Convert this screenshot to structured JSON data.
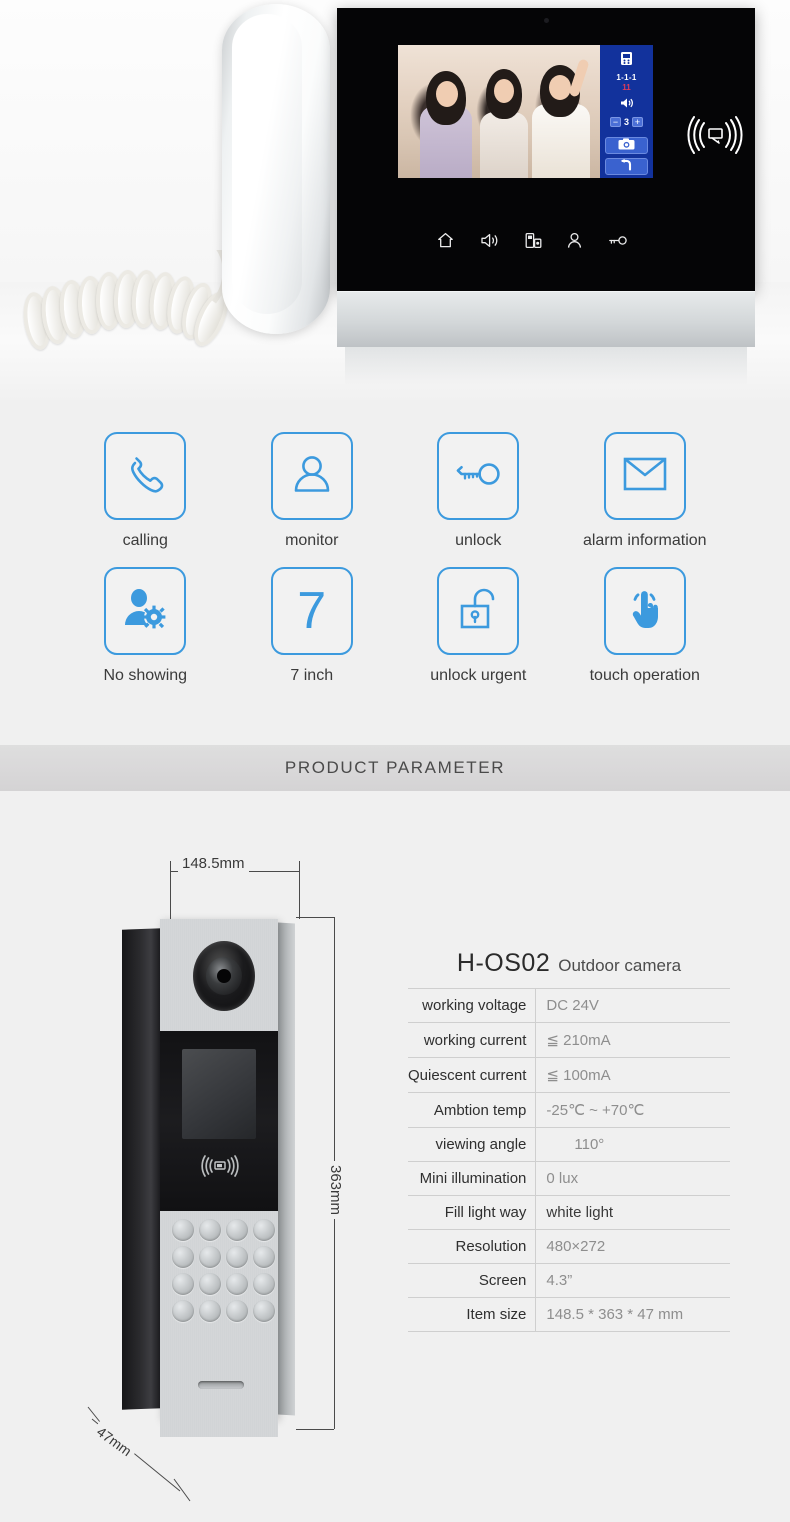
{
  "hero": {
    "device_name": "video-door-phone-indoor-monitor",
    "osd": {
      "station_icon": "door-station-icon",
      "address": "1-1-1",
      "call_number": "11",
      "volume_icon": "speaker-icon",
      "volume_minus": "−",
      "volume_value": "3",
      "volume_plus": "+",
      "snapshot_icon": "camera-icon",
      "back_icon": "back-arrow-icon"
    },
    "touchbar": [
      {
        "name": "home-icon",
        "label": "home"
      },
      {
        "name": "volume-icon",
        "label": "volume"
      },
      {
        "name": "monitor-icon",
        "label": "monitor"
      },
      {
        "name": "contact-icon",
        "label": "contact"
      },
      {
        "name": "key-icon",
        "label": "unlock"
      }
    ],
    "rfid_icon": "rfid-reader-icon"
  },
  "features": {
    "row1": [
      {
        "icon": "phone-handset-icon",
        "label": "calling"
      },
      {
        "icon": "person-icon",
        "label": "monitor"
      },
      {
        "icon": "key-icon",
        "label": "unlock"
      },
      {
        "icon": "envelope-icon",
        "label": "alarm information"
      }
    ],
    "row2": [
      {
        "icon": "person-gear-icon",
        "label": "No showing"
      },
      {
        "icon": "number-seven",
        "glyph": "7",
        "label": "7 inch"
      },
      {
        "icon": "open-padlock-icon",
        "label": "unlock urgent"
      },
      {
        "icon": "touch-finger-icon",
        "label": "touch operation"
      }
    ]
  },
  "banner": {
    "title": "PRODUCT PARAMETER"
  },
  "dimensions": {
    "width": "148.5mm",
    "height": "363mm",
    "depth": "47mm"
  },
  "spec": {
    "model": "H-OS02",
    "subtitle": "Outdoor camera",
    "rows": [
      {
        "key": "working voltage",
        "value": "DC 24V",
        "dark": false
      },
      {
        "key": "working current",
        "value": "≦ 210mA",
        "dark": false
      },
      {
        "key": "Quiescent current",
        "value": "≦ 100mA",
        "dark": false
      },
      {
        "key": "Ambtion temp",
        "value": "-25℃ ~ +70℃",
        "dark": false
      },
      {
        "key": "viewing angle",
        "value": "110°",
        "dark": false
      },
      {
        "key": "Mini illumination",
        "value": "0 lux",
        "dark": false
      },
      {
        "key": "Fill light way",
        "value": "white light",
        "dark": true
      },
      {
        "key": "Resolution",
        "value": "480×272",
        "dark": false
      },
      {
        "key": "Screen",
        "value": "4.3”",
        "dark": false
      },
      {
        "key": "Item size",
        "value": "148.5 * 363 * 47 mm",
        "dark": false
      }
    ]
  },
  "colors": {
    "accent_blue": "#3c9ade",
    "osd_blue": "#12329c",
    "page_bg": "#f0f0f0",
    "banner_bg": "#d9d8d9",
    "alert_red": "#e23b5a"
  }
}
